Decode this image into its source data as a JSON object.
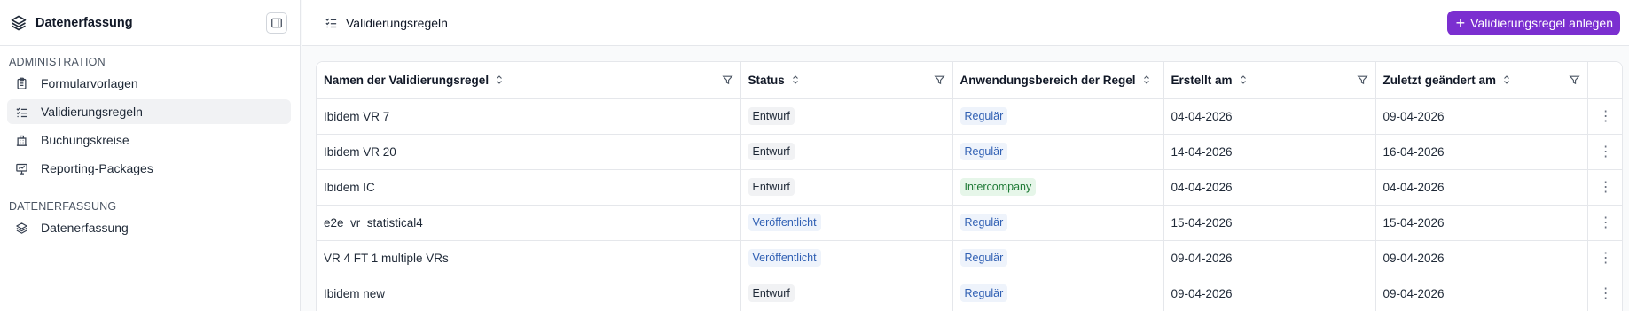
{
  "sidebar": {
    "app_title": "Datenerfassung",
    "sections": [
      {
        "label": "ADMINISTRATION",
        "items": [
          {
            "label": "Formularvorlagen",
            "icon": "clipboard-icon"
          },
          {
            "label": "Validierungsregeln",
            "icon": "list-check-icon",
            "active": true
          },
          {
            "label": "Buchungskreise",
            "icon": "building-icon"
          },
          {
            "label": "Reporting-Packages",
            "icon": "presentation-icon"
          }
        ]
      },
      {
        "label": "DATENERFASSUNG",
        "items": [
          {
            "label": "Datenerfassung",
            "icon": "layers-icon"
          }
        ]
      }
    ]
  },
  "topbar": {
    "breadcrumb": "Validierungsregeln",
    "add_button_label": "Validierungsregel anlegen"
  },
  "table": {
    "columns": [
      "Namen der Validierungsregel",
      "Status",
      "Anwendungsbereich der Regel",
      "Erstellt am",
      "Zuletzt geändert am"
    ],
    "rows": [
      {
        "name": "Ibidem VR 7",
        "status": "Entwurf",
        "scope": "Regulär",
        "created": "04-04-2026",
        "modified": "09-04-2026"
      },
      {
        "name": "Ibidem VR 20",
        "status": "Entwurf",
        "scope": "Regulär",
        "created": "14-04-2026",
        "modified": "16-04-2026"
      },
      {
        "name": "Ibidem IC",
        "status": "Entwurf",
        "scope": "Intercompany",
        "created": "04-04-2026",
        "modified": "04-04-2026"
      },
      {
        "name": "e2e_vr_statistical4",
        "status": "Veröffentlicht",
        "scope": "Regulär",
        "created": "15-04-2026",
        "modified": "15-04-2026"
      },
      {
        "name": "VR 4 FT 1 multiple VRs",
        "status": "Veröffentlicht",
        "scope": "Regulär",
        "created": "09-04-2026",
        "modified": "09-04-2026"
      },
      {
        "name": "Ibidem new",
        "status": "Entwurf",
        "scope": "Regulär",
        "created": "09-04-2026",
        "modified": "09-04-2026"
      }
    ]
  },
  "colors": {
    "accent": "#7b2fd0",
    "status_draft_bg": "#f1f2f4",
    "status_published_fg": "#2f5fb3",
    "scope_regular_fg": "#2f5fb3",
    "scope_intercompany_fg": "#1f7a36"
  }
}
